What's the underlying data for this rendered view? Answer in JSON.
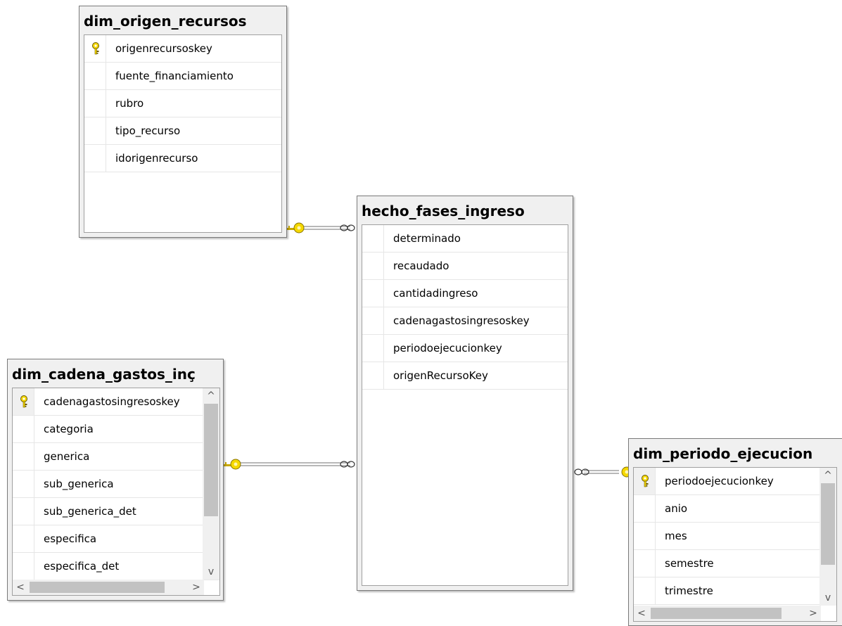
{
  "tables": {
    "origen": {
      "title": "dim_origen_recursos",
      "fields": [
        "origenrecursoskey",
        "fuente_financiamiento",
        "rubro",
        "tipo_recurso",
        "idorigenrecurso"
      ]
    },
    "hecho": {
      "title": "hecho_fases_ingreso",
      "fields": [
        "determinado",
        "recaudado",
        "cantidadingreso",
        "cadenagastosingresoskey",
        "periodoejecucionkey",
        "origenRecursoKey"
      ]
    },
    "cadena": {
      "title": "dim_cadena_gastos_inç",
      "fields": [
        "cadenagastosingresoskey",
        "categoria",
        "generica",
        "sub_generica",
        "sub_generica_det",
        "especifica",
        "especifica_det"
      ]
    },
    "periodo": {
      "title": "dim_periodo_ejecucion",
      "fields": [
        "periodoejecucionkey",
        "anio",
        "mes",
        "semestre",
        "trimestre"
      ]
    }
  },
  "icons": {
    "primary_key": "key-icon",
    "relationship_one": "key-end-icon",
    "relationship_many": "infinity-icon"
  },
  "colors": {
    "key": "#e6c619",
    "line": "#808080"
  },
  "scroll": {
    "up": "^",
    "down": "v",
    "left": "<",
    "right": ">"
  }
}
